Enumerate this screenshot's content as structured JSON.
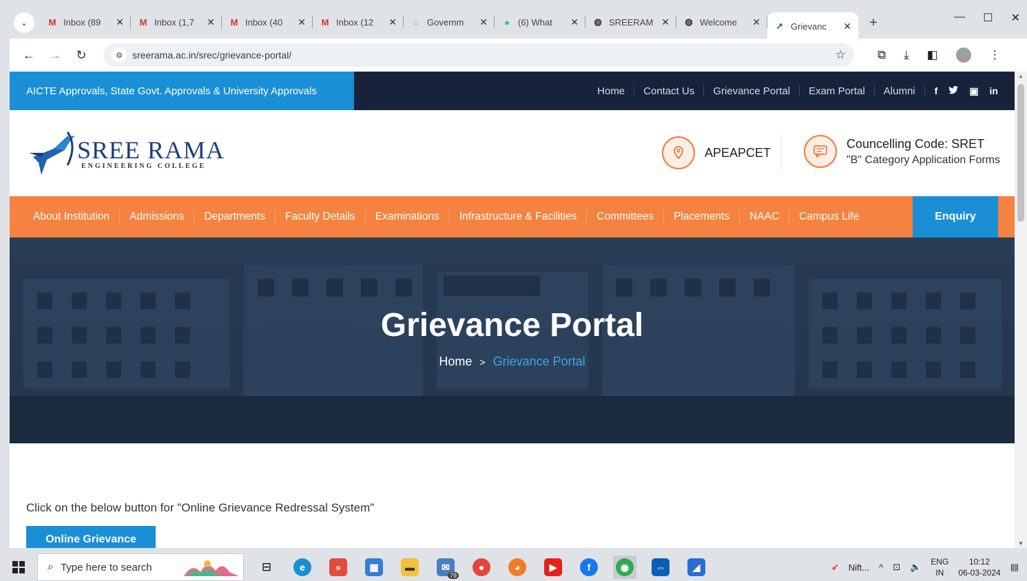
{
  "browser": {
    "tabs": [
      {
        "icon": "gmail-icon",
        "title": "Inbox (89",
        "active": false
      },
      {
        "icon": "gmail-icon",
        "title": "Inbox (1,7",
        "active": false
      },
      {
        "icon": "gmail-icon",
        "title": "Inbox (40",
        "active": false
      },
      {
        "icon": "gmail-icon",
        "title": "Inbox (12",
        "active": false
      },
      {
        "icon": "globe-icon",
        "title": "Governm",
        "active": false
      },
      {
        "icon": "whatsapp-icon",
        "title": "(6) What",
        "active": false
      },
      {
        "icon": "site-icon",
        "title": "SREERAM",
        "active": false
      },
      {
        "icon": "site-icon",
        "title": "Welcome",
        "active": false
      },
      {
        "icon": "college-icon",
        "title": "Grievanc",
        "active": true
      }
    ],
    "url": "sreerama.ac.in/srec/grievance-portal/"
  },
  "site": {
    "approvals": "AICTE Approvals, State Govt. Approvals & University Approvals",
    "top_links": [
      "Home",
      "Contact Us",
      "Grievance Portal",
      "Exam Portal",
      "Alumni"
    ],
    "social": [
      "f",
      "t",
      "▣",
      "in"
    ],
    "logo_name": "SREE RAMA",
    "logo_sub": "ENGINEERING COLLEGE",
    "apeapcet": "APEAPCET",
    "counselling_code": "Councelling Code: SRET",
    "category_forms": "\"B\" Category Application Forms",
    "nav": [
      "About Institution",
      "Admissions",
      "Departments",
      "Faculty Details",
      "Examinations",
      "Infrastructure & Facilities",
      "Committees",
      "Placements",
      "NAAC",
      "Campus Life"
    ],
    "enquiry": "Enquiry",
    "hero_title": "Grievance Portal",
    "crumb_home": "Home",
    "crumb_sep": ">",
    "crumb_current": "Grievance Portal",
    "intro": "Click on the below button for \"Online Grievance Redressal System\"",
    "button": "Online Grievance"
  },
  "taskbar": {
    "search_placeholder": "Type here to search",
    "mail_badge": "79",
    "nifty": "Nift...",
    "lang_top": "ENG",
    "lang_bottom": "IN",
    "time": "10:12",
    "date": "06-03-2024"
  },
  "colors": {
    "topbar": "#17223b",
    "accent_blue": "#1a8fd6",
    "nav_orange": "#f5823f"
  }
}
